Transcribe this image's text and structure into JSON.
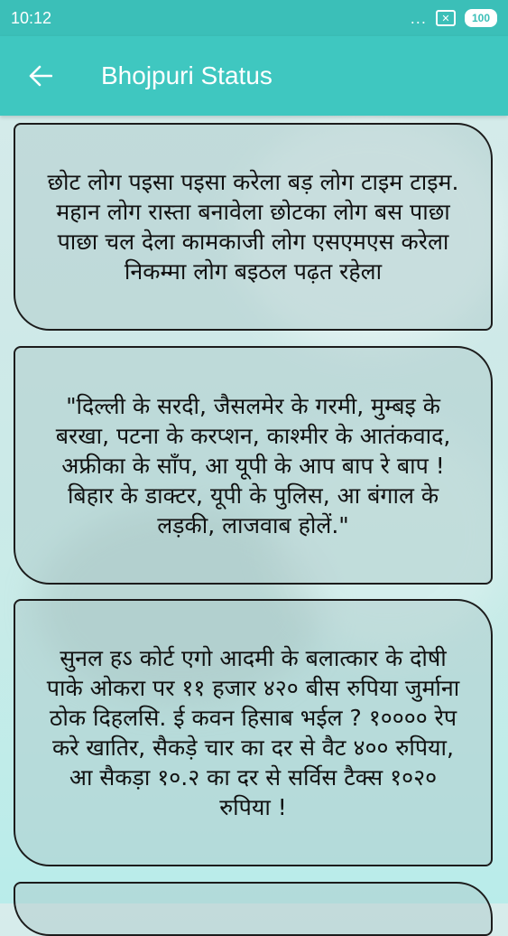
{
  "status_bar": {
    "time": "10:12",
    "dots": "...",
    "notification_icon": "x-box-icon",
    "battery": "100"
  },
  "app_bar": {
    "back_icon": "arrow-left-icon",
    "title": "Bhojpuri Status"
  },
  "cards": [
    {
      "text": "छोट लोग पइसा पइसा करेला बड़ लोग टाइम टाइम. महान लोग रास्ता बनावेला छोटका लोग बस पाछा पाछा चल देला कामकाजी लोग एसएमएस करेला निकम्मा लोग बइठल पढ़त रहेला"
    },
    {
      "text": "\"दिल्ली के सरदी, जैसलमेर के गरमी, मुम्बइ के बरखा, पटना के करप्शन, काश्मीर के आतंकवाद, अफ्रीका के साँप, आ यूपी के आप बाप रे बाप ! बिहार के डाक्टर, यूपी के पुलिस, आ बंगाल के लड़की, लाजवाब होलें.\""
    },
    {
      "text": "सुनल हऽ कोर्ट एगो आदमी के बलात्कार के दोषी पाके ओकरा पर ११ हजार ४२० बीस रुपिया जुर्माना ठोक दिहलसि. ई कवन हिसाब भईल ? १०००० रेप करे खातिर, सैकड़े चार का दर से वैट ४०० रुपिया, आ सैकड़ा १०.२ का दर से सर्विस टैक्स १०२० रुपिया !"
    },
    {
      "text": ""
    }
  ],
  "colors": {
    "status_bar": "#3bbfb8",
    "app_bar": "#3fc7c0",
    "card_border": "#1c1c1c"
  }
}
